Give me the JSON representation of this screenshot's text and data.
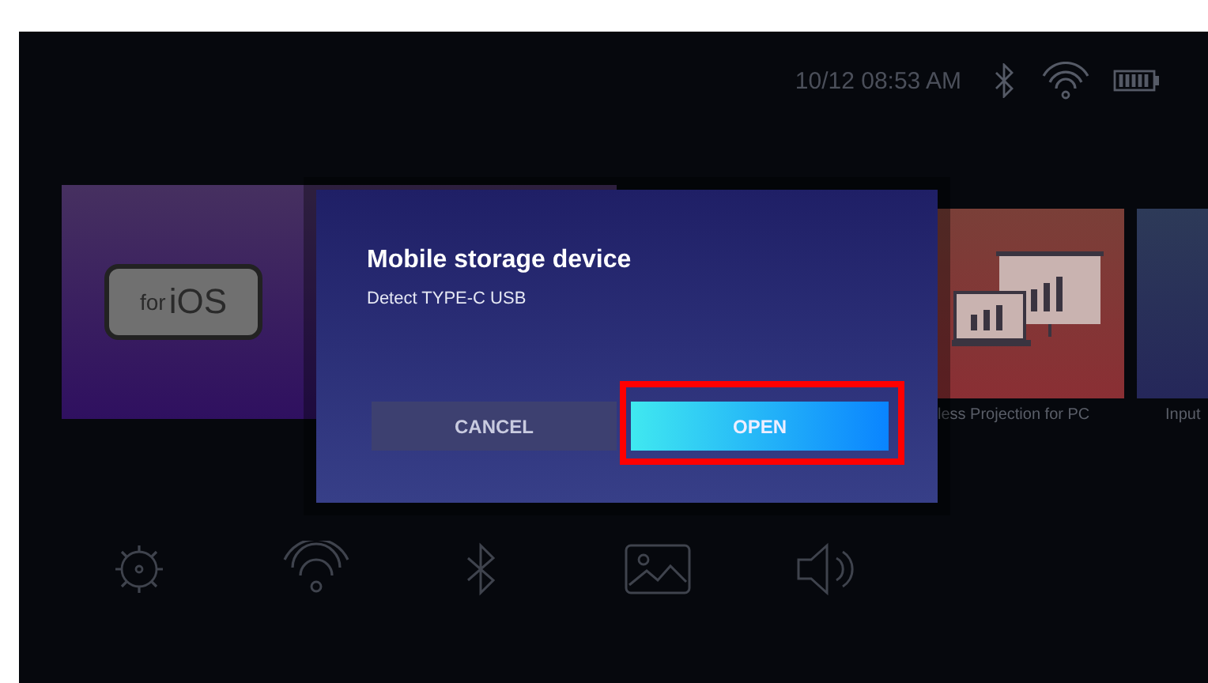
{
  "status_bar": {
    "time": "10/12 08:53 AM"
  },
  "apps": [
    {
      "kind": "ios",
      "logo_small": "for",
      "logo_large": "iOS"
    },
    {
      "kind": "projection",
      "label": "less Projection for PC"
    },
    {
      "kind": "plain",
      "label": "Input"
    }
  ],
  "dialog": {
    "title": "Mobile storage device",
    "message": "Detect TYPE-C USB",
    "buttons": [
      {
        "label": "CANCEL",
        "selected": false
      },
      {
        "label": "OPEN",
        "selected": true
      }
    ]
  },
  "quick_settings": [
    {
      "kind": "brightness"
    },
    {
      "kind": "wifi"
    },
    {
      "kind": "bluetooth"
    },
    {
      "kind": "picture"
    },
    {
      "kind": "volume"
    }
  ]
}
